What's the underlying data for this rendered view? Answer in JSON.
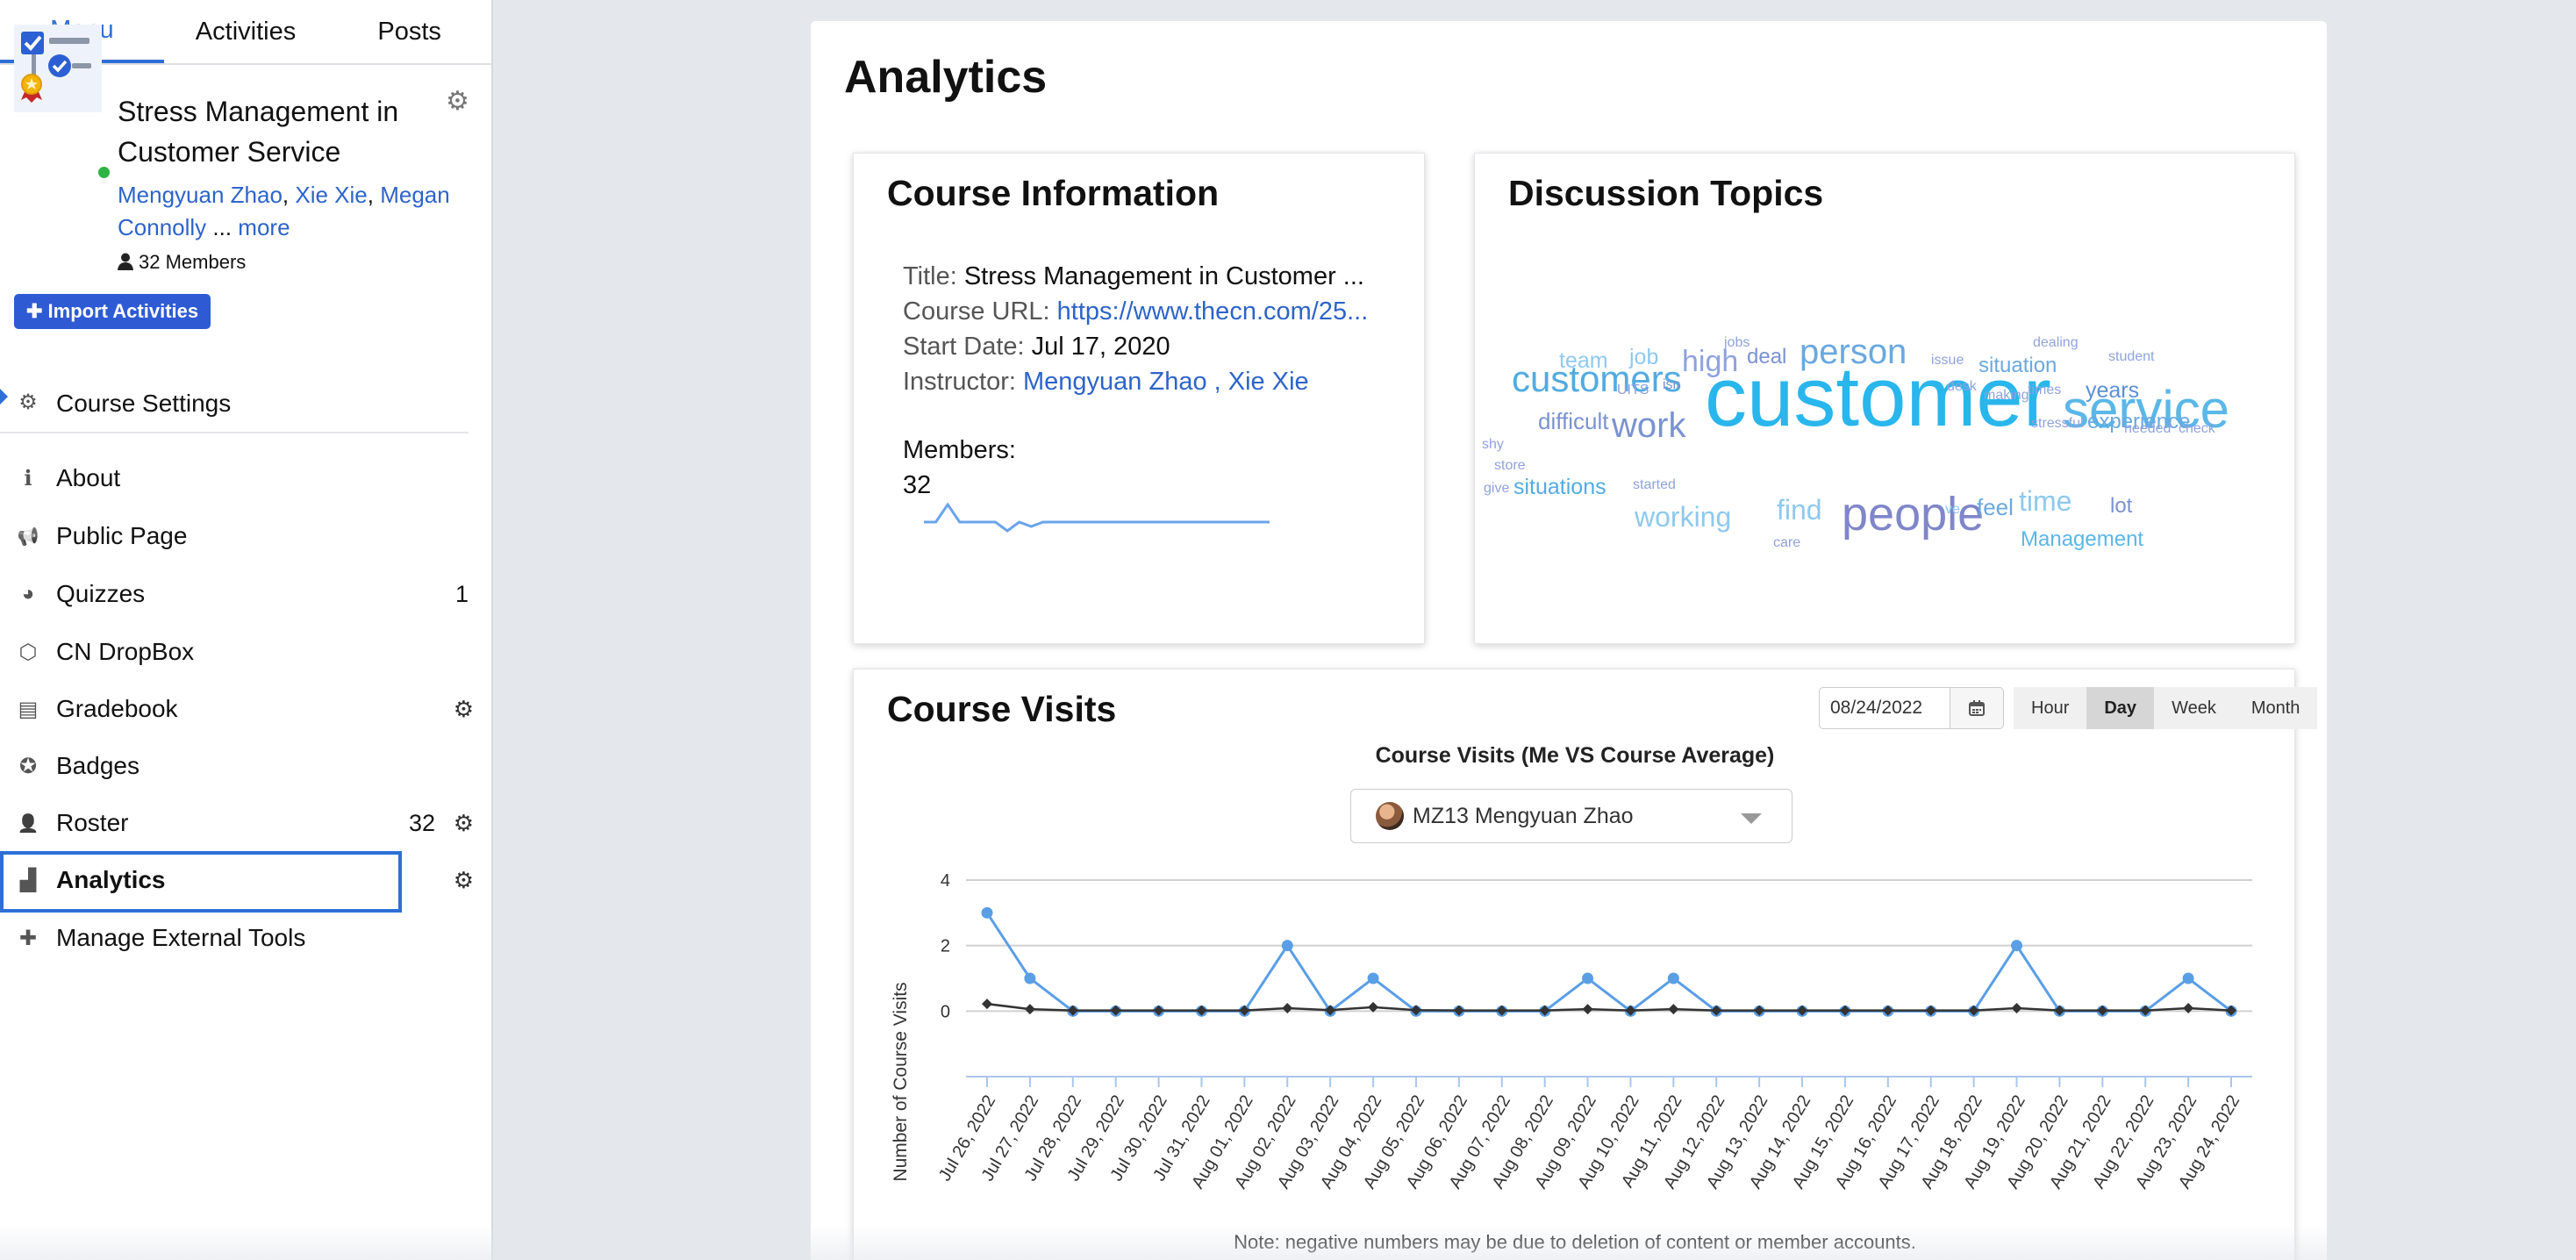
{
  "tabs": [
    "Menu",
    "Activities",
    "Posts"
  ],
  "course": {
    "title": "Stress Management in Customer Service",
    "instructors": [
      "Mengyuan Zhao",
      "Xie Xie",
      "Megan Connolly"
    ],
    "more": "more",
    "ellipsis": " ... ",
    "members": "32 Members"
  },
  "import_label": "Import Activities",
  "nav": {
    "course_settings": "Course Settings",
    "items": [
      {
        "label": "About",
        "icon": "info-icon"
      },
      {
        "label": "Public Page",
        "icon": "megaphone-icon"
      },
      {
        "label": "Quizzes",
        "icon": "brain-icon",
        "count": "1"
      },
      {
        "label": "CN DropBox",
        "icon": "box-icon"
      },
      {
        "label": "Gradebook",
        "icon": "document-icon",
        "gear": true
      },
      {
        "label": "Badges",
        "icon": "badge-icon"
      },
      {
        "label": "Roster",
        "icon": "user-icon",
        "count": "32",
        "gear": true
      },
      {
        "label": "Analytics",
        "icon": "chart-icon",
        "gear": true,
        "active": true
      },
      {
        "label": "Manage External Tools",
        "icon": "plus-icon"
      }
    ]
  },
  "page_title": "Analytics",
  "course_info": {
    "heading": "Course Information",
    "title_label": "Title: ",
    "title_value": "Stress Management in Customer ...",
    "url_label": "Course URL: ",
    "url_value": "https://www.thecn.com/25...",
    "start_label": "Start Date: ",
    "start_value": "Jul 17, 2020",
    "instructor_label": "Instructor: ",
    "instructor_value": "Mengyuan Zhao , Xie Xie",
    "members_label": "Members:",
    "members_value": "32"
  },
  "discussion": {
    "heading": "Discussion Topics",
    "words": [
      {
        "t": "customer",
        "fs": 96,
        "c": "#29b6ec"
      },
      {
        "t": "service",
        "fs": 60,
        "c": "#5ab7e8"
      },
      {
        "t": "people",
        "fs": 54,
        "c": "#7f86c9"
      },
      {
        "t": "customers",
        "fs": 42,
        "c": "#52abe0"
      },
      {
        "t": "person",
        "fs": 40,
        "c": "#6aa8e0"
      },
      {
        "t": "work",
        "fs": 40,
        "c": "#7a92d0"
      },
      {
        "t": "high",
        "fs": 34,
        "c": "#8fa2de"
      },
      {
        "t": "working",
        "fs": 32,
        "c": "#8ec9ee"
      },
      {
        "t": "find",
        "fs": 32,
        "c": "#8ec9ee"
      },
      {
        "t": "time",
        "fs": 32,
        "c": "#8ec9ee"
      },
      {
        "t": "feel",
        "fs": 26,
        "c": "#6aa8e0"
      },
      {
        "t": "difficult",
        "fs": 26,
        "c": "#7a92d0"
      },
      {
        "t": "situations",
        "fs": 25,
        "c": "#52abe0"
      },
      {
        "t": "Management",
        "fs": 24,
        "c": "#5ab7e8"
      },
      {
        "t": "experience",
        "fs": 24,
        "c": "#6aa8e0"
      },
      {
        "t": "years",
        "fs": 25,
        "c": "#5a90d6"
      },
      {
        "t": "situation",
        "fs": 24,
        "c": "#6aa8e0"
      },
      {
        "t": "team",
        "fs": 25,
        "c": "#8ec9ee"
      },
      {
        "t": "job",
        "fs": 25,
        "c": "#8ec9ee"
      },
      {
        "t": "deal",
        "fs": 24,
        "c": "#7a92d0"
      },
      {
        "t": "lot",
        "fs": 24,
        "c": "#7a92d0"
      },
      {
        "t": "ve",
        "fs": 16,
        "c": "#8ec9ee"
      },
      {
        "t": "jobs",
        "fs": 16,
        "c": "#8fa2de"
      },
      {
        "t": "UITS",
        "fs": 16,
        "c": "#8fa2de"
      },
      {
        "t": "isn",
        "fs": 16,
        "c": "#7a92d0"
      },
      {
        "t": "issue",
        "fs": 16,
        "c": "#8fa2de"
      },
      {
        "t": "desk",
        "fs": 16,
        "c": "#8fa2de"
      },
      {
        "t": "making",
        "fs": 16,
        "c": "#8fa2de"
      },
      {
        "t": "times",
        "fs": 16,
        "c": "#8fa2de"
      },
      {
        "t": "dealing",
        "fs": 16,
        "c": "#8fa2de"
      },
      {
        "t": "student",
        "fs": 16,
        "c": "#8fa2de"
      },
      {
        "t": "stressful",
        "fs": 16,
        "c": "#8fa2de"
      },
      {
        "t": "needed",
        "fs": 16,
        "c": "#8fa2de"
      },
      {
        "t": "check",
        "fs": 16,
        "c": "#8fa2de"
      },
      {
        "t": "shy",
        "fs": 16,
        "c": "#8fa2de"
      },
      {
        "t": "store",
        "fs": 16,
        "c": "#8fa2de"
      },
      {
        "t": "give",
        "fs": 16,
        "c": "#8fa2de"
      },
      {
        "t": "started",
        "fs": 16,
        "c": "#8fa2de"
      },
      {
        "t": "care",
        "fs": 16,
        "c": "#8fa2de"
      }
    ]
  },
  "visits": {
    "heading": "Course Visits",
    "date": "08/24/2022",
    "ranges": [
      "Hour",
      "Day",
      "Week",
      "Month"
    ],
    "active_range": "Day",
    "user": "MZ13 Mengyuan Zhao",
    "note": "Note: negative numbers may be due to deletion of content or member accounts."
  },
  "chart_data": {
    "type": "line",
    "title": "Course Visits (Me VS Course Average)",
    "ylabel": "Number of Course Visits",
    "ylim": [
      -2,
      4
    ],
    "yticks": [
      0,
      2,
      4
    ],
    "categories": [
      "Jul 26, 2022",
      "Jul 27, 2022",
      "Jul 28, 2022",
      "Jul 29, 2022",
      "Jul 30, 2022",
      "Jul 31, 2022",
      "Aug 01, 2022",
      "Aug 02, 2022",
      "Aug 03, 2022",
      "Aug 04, 2022",
      "Aug 05, 2022",
      "Aug 06, 2022",
      "Aug 07, 2022",
      "Aug 08, 2022",
      "Aug 09, 2022",
      "Aug 10, 2022",
      "Aug 11, 2022",
      "Aug 12, 2022",
      "Aug 13, 2022",
      "Aug 14, 2022",
      "Aug 15, 2022",
      "Aug 16, 2022",
      "Aug 17, 2022",
      "Aug 18, 2022",
      "Aug 19, 2022",
      "Aug 20, 2022",
      "Aug 21, 2022",
      "Aug 22, 2022",
      "Aug 23, 2022",
      "Aug 24, 2022"
    ],
    "series": [
      {
        "color": "#5a9ee6",
        "marker": "circle",
        "values": [
          3,
          1,
          0,
          0,
          0,
          0,
          0,
          2,
          0,
          1,
          0,
          0,
          0,
          0,
          1,
          0,
          1,
          0,
          0,
          0,
          0,
          0,
          0,
          0,
          2,
          0,
          0,
          0,
          1,
          0
        ]
      },
      {
        "color": "#333333",
        "marker": "diamond",
        "values": [
          0.22,
          0.06,
          0.02,
          0.02,
          0.02,
          0.02,
          0.02,
          0.09,
          0.03,
          0.12,
          0.03,
          0.02,
          0.02,
          0.02,
          0.06,
          0.02,
          0.06,
          0.02,
          0.02,
          0.02,
          0.02,
          0.02,
          0.02,
          0.02,
          0.09,
          0.02,
          0.02,
          0.02,
          0.09,
          0.02
        ]
      }
    ],
    "grid": true,
    "legend": "none"
  },
  "sparkline": {
    "values": [
      32,
      32,
      34,
      32,
      32,
      32,
      32,
      31,
      32,
      31.5,
      32,
      32,
      32,
      32,
      32,
      32,
      32,
      32,
      32,
      32,
      32,
      32,
      32,
      32,
      32,
      32,
      32,
      32,
      32,
      32
    ]
  },
  "colors": {
    "accent": "#2d6fd6",
    "button": "#2e5bd4",
    "online": "#2fb344"
  }
}
